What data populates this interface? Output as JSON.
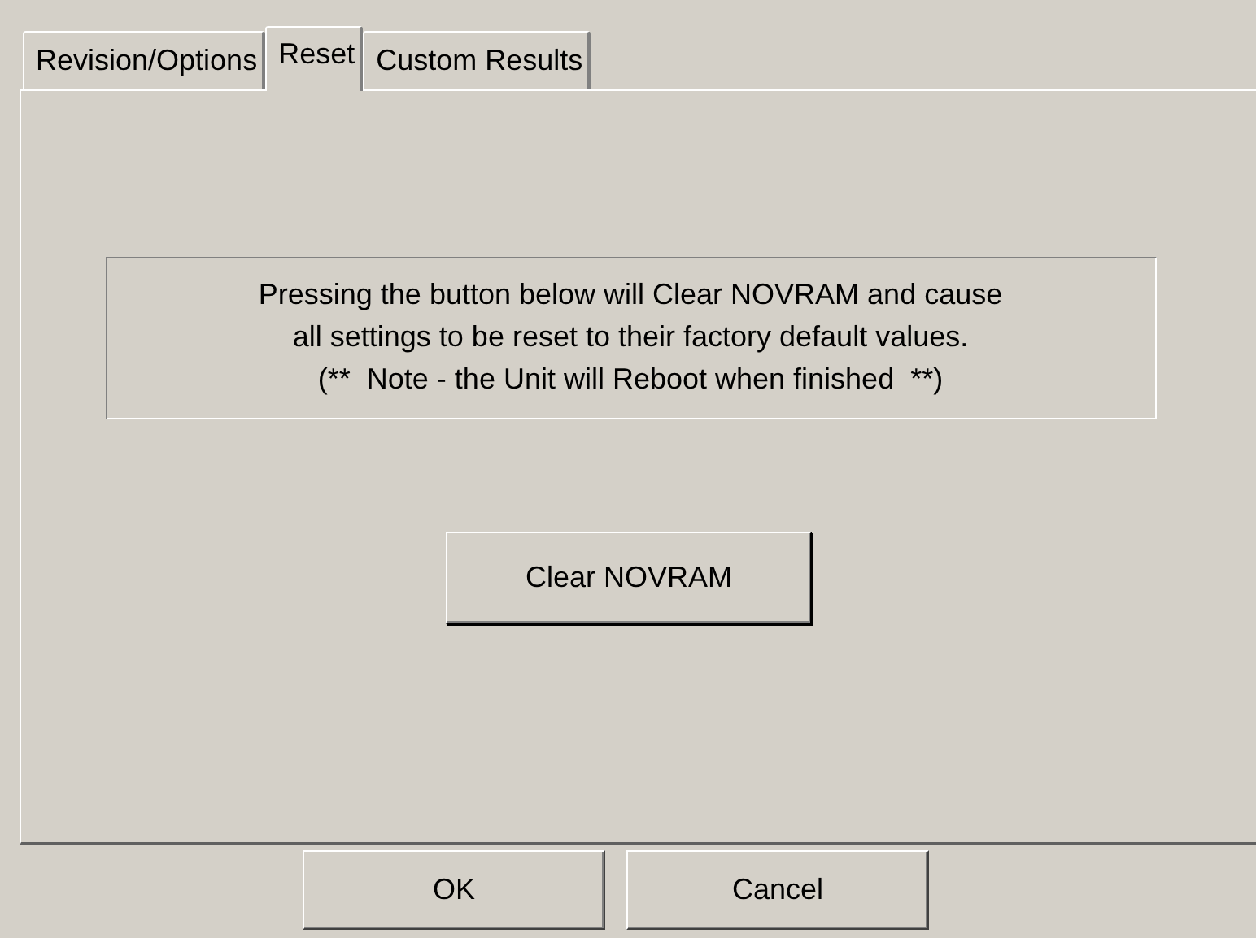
{
  "tabs": [
    {
      "label": "Revision/Options",
      "selected": false
    },
    {
      "label": "Reset",
      "selected": true
    },
    {
      "label": "Custom Results",
      "selected": false
    }
  ],
  "message": "Pressing the button below will Clear NOVRAM and cause\nall settings to be reset to their factory default values.\n(**  Note - the Unit will Reboot when finished  **)",
  "action_button": "Clear NOVRAM",
  "buttons": [
    "OK",
    "Cancel"
  ]
}
